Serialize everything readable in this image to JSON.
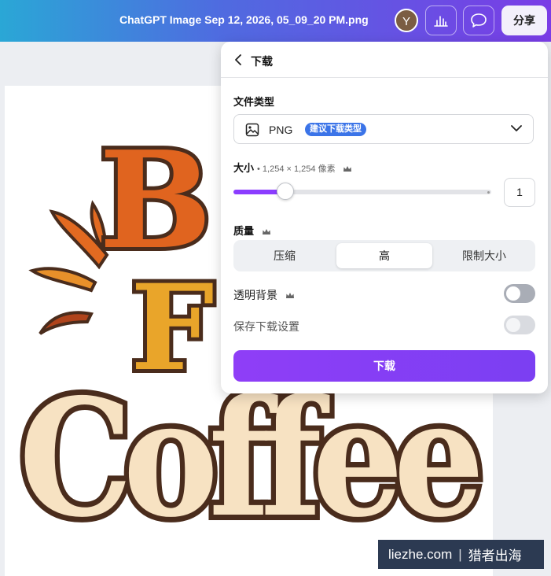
{
  "topbar": {
    "title": "ChatGPT Image Sep 12, 2026, 05_09_20 PM.png",
    "avatar_initial": "Y",
    "share_label": "分享",
    "icons": [
      "analytics-icon",
      "comment-icon"
    ]
  },
  "canvas": {
    "design_text_line1": "B",
    "design_text_line2": "F",
    "design_text_line3": "Coffee"
  },
  "panel": {
    "title": "下载",
    "file_type": {
      "label": "文件类型",
      "value": "PNG",
      "badge": "建议下载类型"
    },
    "size": {
      "label": "大小",
      "meta": "• 1,254 × 1,254 像素",
      "value": "1",
      "slider_fraction": 0.2
    },
    "quality": {
      "label": "质量",
      "options": [
        "压缩",
        "高",
        "限制大小"
      ],
      "selected_index": 1
    },
    "transparent_bg": {
      "label": "透明背景",
      "enabled": false
    },
    "save_settings": {
      "label": "保存下载设置",
      "enabled": false
    },
    "download_label": "下载"
  },
  "watermark": {
    "site": "liezhe.com",
    "brand": "猎者出海"
  },
  "colors": {
    "accent": "#8b3dff",
    "badge": "#3b74e8",
    "coffee_cream": "#f7e2c2",
    "coffee_brown": "#4a2c1c",
    "orange": "#e0641f",
    "yellow": "#e9a52a"
  }
}
